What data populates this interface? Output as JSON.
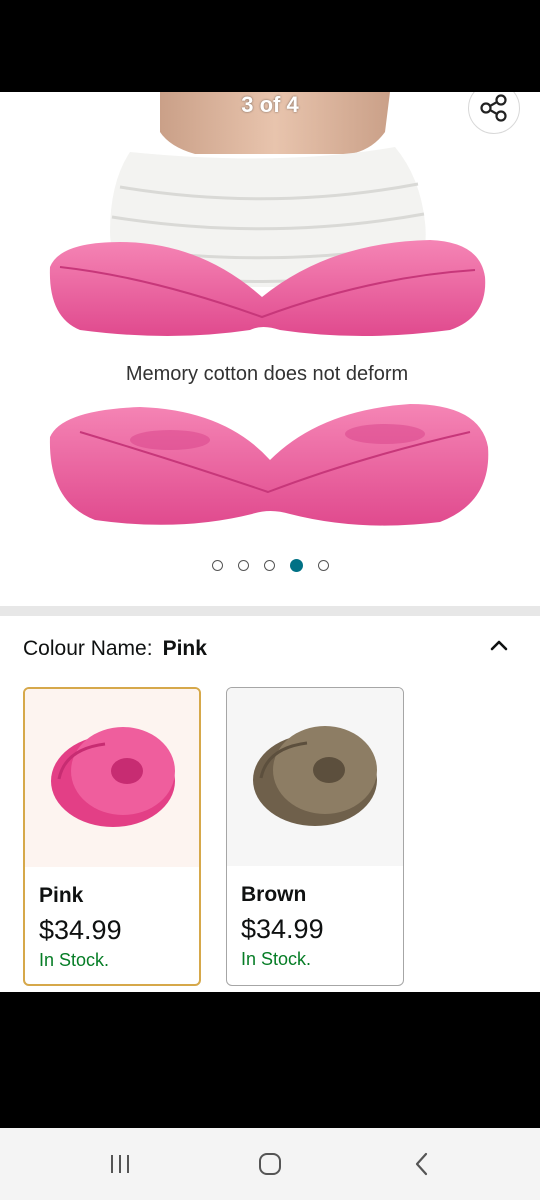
{
  "gallery": {
    "counter": "3 of 4",
    "caption": "Memory cotton does not deform",
    "dots_total": 5,
    "dots_active_index": 3
  },
  "variation": {
    "label": "Colour Name:",
    "selected_value": "Pink",
    "options": [
      {
        "name": "Pink",
        "price": "$34.99",
        "stock": "In Stock.",
        "selected": true,
        "color": "#ec4f93"
      },
      {
        "name": "Brown",
        "price": "$34.99",
        "stock": "In Stock.",
        "selected": false,
        "color": "#8a7a62"
      }
    ]
  },
  "colors": {
    "accent": "#007185",
    "selected_border": "#d6a84a",
    "in_stock": "#067d26",
    "pink": "#ec4f93"
  },
  "icons": {
    "share": "share-icon",
    "collapse": "chevron-up-icon",
    "nav_recents": "recents-icon",
    "nav_home": "home-icon",
    "nav_back": "back-icon"
  }
}
